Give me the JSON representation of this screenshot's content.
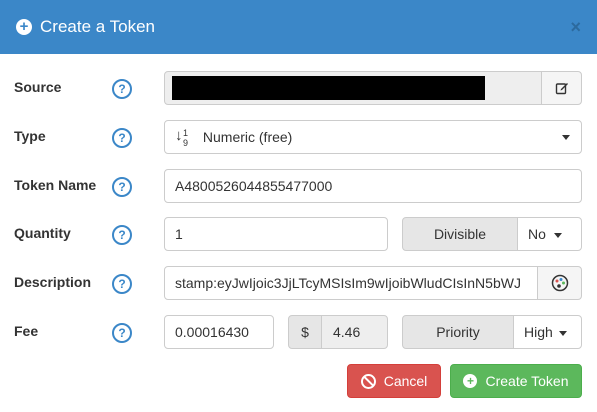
{
  "dialog": {
    "title": "Create a Token",
    "header_icon": "plus-circle-icon",
    "close_glyph": "×"
  },
  "help_glyph": "?",
  "fields": {
    "source": {
      "label": "Source"
    },
    "type": {
      "label": "Type",
      "value": "Numeric (free)",
      "icon": "sort-numeric-icon"
    },
    "token_name": {
      "label": "Token Name",
      "value": "A4800526044855477000"
    },
    "quantity": {
      "label": "Quantity",
      "value": "1",
      "divisible_label": "Divisible",
      "divisible_value": "No"
    },
    "description": {
      "label": "Description",
      "value": "stamp:eyJwIjoic3JjLTcyMSIsIm9wIjoibWludCIsInN5bWJ",
      "icon": "palette-icon"
    },
    "fee": {
      "label": "Fee",
      "value": "0.00016430",
      "currency_symbol": "$",
      "usd_value": "4.46",
      "priority_label": "Priority",
      "priority_value": "High"
    }
  },
  "buttons": {
    "cancel": "Cancel",
    "create": "Create Token"
  },
  "colors": {
    "header": "#3b87c8",
    "cancel": "#d9534f",
    "create": "#5cb85c"
  }
}
